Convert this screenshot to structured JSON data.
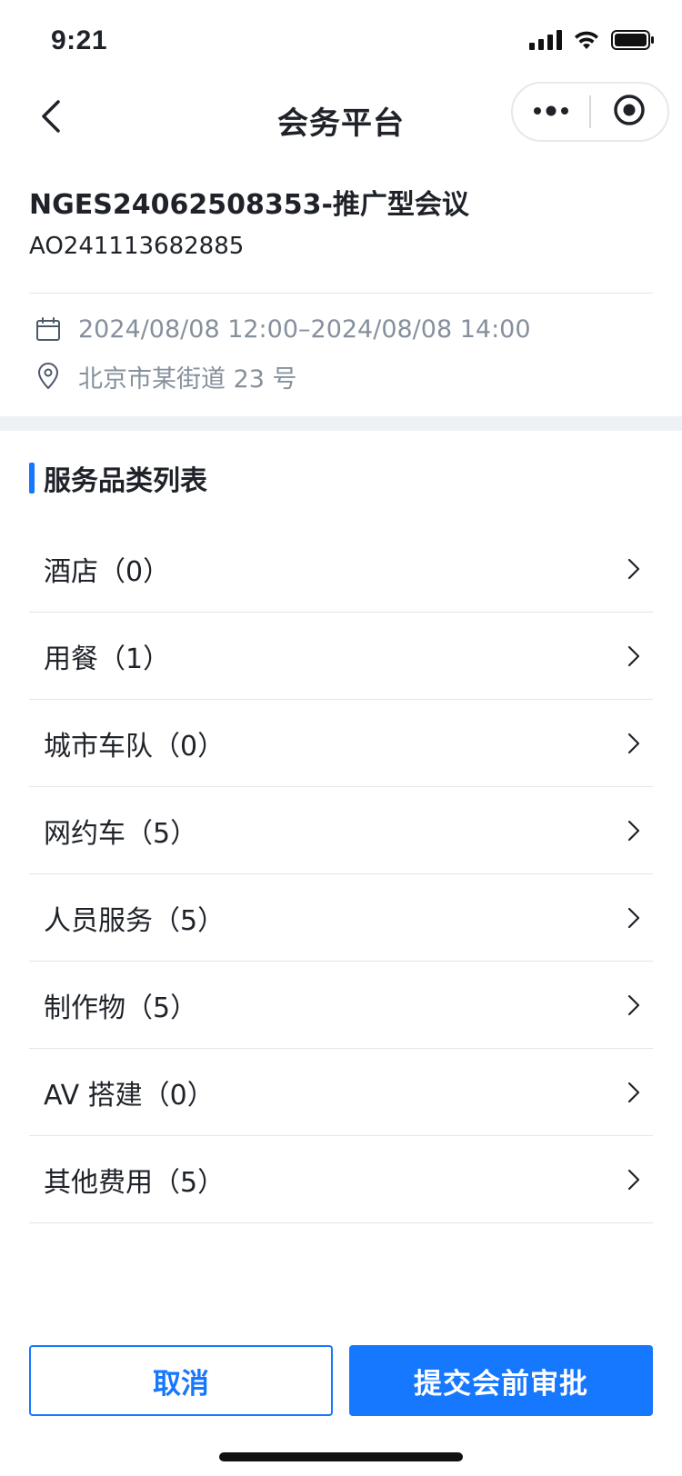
{
  "status_bar": {
    "time": "9:21"
  },
  "nav": {
    "title": "会务平台",
    "back_icon": "chevron-left-icon",
    "more_icon": "more-dots-icon",
    "close_icon": "target-circle-icon"
  },
  "header": {
    "order_title": "NGES24062508353-推广型会议",
    "order_code": "AO241113682885",
    "time_range": "2024/08/08 12:00–2024/08/08 14:00",
    "address": "北京市某街道 23 号"
  },
  "section": {
    "title": "服务品类列表"
  },
  "categories": [
    {
      "label": "酒店（0）"
    },
    {
      "label": "用餐（1）"
    },
    {
      "label": "城市车队（0）"
    },
    {
      "label": "网约车（5）"
    },
    {
      "label": "人员服务（5）"
    },
    {
      "label": "制作物（5）"
    },
    {
      "label": "AV 搭建（0）"
    },
    {
      "label": "其他费用（5）"
    }
  ],
  "actions": {
    "cancel_label": "取消",
    "submit_label": "提交会前审批"
  },
  "colors": {
    "accent": "#1677ff",
    "text_primary": "#1f2329",
    "text_secondary": "#86909c",
    "divider": "#e5e6eb"
  }
}
